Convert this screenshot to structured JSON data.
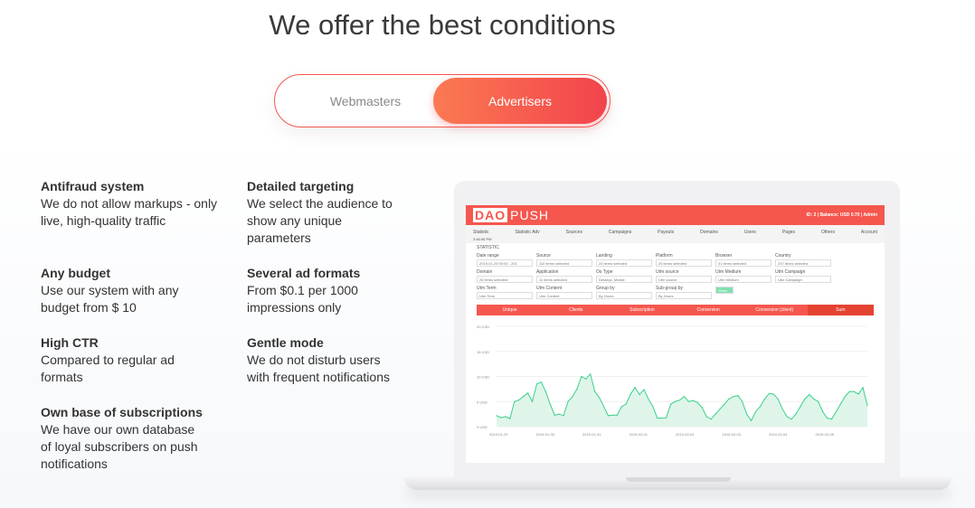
{
  "heading": "We offer the best conditions",
  "toggle": {
    "options": [
      "Webmasters",
      "Advertisers"
    ],
    "active": "Advertisers"
  },
  "features": [
    {
      "title": "Antifraud system",
      "text": "We do not allow markups - only live, high-quality traffic"
    },
    {
      "title": "Detailed targeting",
      "text": "We select the audience to show any unique parameters"
    },
    {
      "title": "Any budget",
      "text": "Use our system with any budget from $ 10"
    },
    {
      "title": "Several ad formats",
      "text": "From $0.1 per 1000 impressions only"
    },
    {
      "title": "High CTR",
      "text": "Compared to regular ad formats"
    },
    {
      "title": "Gentle mode",
      "text": "We do not disturb users with frequent notifications"
    },
    {
      "title": "Own base of subscriptions",
      "text": "We have our own database of loyal subscribers on push notifications"
    }
  ],
  "screen": {
    "logo": "DAO PUSH",
    "logo_a": "DAO",
    "logo_b": "PUSH",
    "top_right": "ID: 2  |  Balance: USD 0.70  |  Admin",
    "nav": [
      "Statistic",
      "Statistic Adv",
      "Sources",
      "Campaigns",
      "Payouts",
      "Domains",
      "Users",
      "Pages",
      "Others",
      "Account"
    ],
    "time": "3:46:06 PM",
    "section": "STATISTIC",
    "filters": [
      [
        {
          "label": "Date range",
          "value": "2019-01-29 00:00 - 201"
        },
        {
          "label": "Source",
          "value": "110 items selected"
        },
        {
          "label": "Landing",
          "value": "24 items selected"
        },
        {
          "label": "Platform",
          "value": "25 items selected"
        },
        {
          "label": "Browser",
          "value": "31 items selected"
        },
        {
          "label": "Country",
          "value": "237 items selected"
        }
      ],
      [
        {
          "label": "Domain",
          "value": "26 items selected"
        },
        {
          "label": "Application",
          "value": "11 items selected"
        },
        {
          "label": "Os Type",
          "value": "Desktop, Mobile"
        },
        {
          "label": "Utm source",
          "value": "Utm source"
        },
        {
          "label": "Utm Medium",
          "value": "Utm Medium"
        },
        {
          "label": "Utm Campaign",
          "value": "Utm Campaign"
        }
      ],
      [
        {
          "label": "Utm Term",
          "value": "Utm Term"
        },
        {
          "label": "Utm Content",
          "value": "Utm Content"
        },
        {
          "label": "Group by",
          "value": "By Hours"
        },
        {
          "label": "Sub-group by",
          "value": "By Hours"
        },
        {
          "label": "",
          "value": "Show"
        }
      ]
    ],
    "metric_tabs": [
      "Unique",
      "Clients",
      "Subscription",
      "Conversion",
      "Conversion (client)",
      "Sum"
    ],
    "active_metric": "Sum"
  },
  "chart_data": {
    "type": "area",
    "y_ticks": [
      "20 USD",
      "15 USD",
      "10 USD",
      "5 USD",
      "0 USD"
    ],
    "ylim": [
      0,
      20
    ],
    "x_ticks": [
      "2019-01-29",
      "2019-01-30",
      "2019-01-31",
      "2019-02-01",
      "2019-02-02",
      "2019-02-03",
      "2019-02-04",
      "2019-02-05"
    ],
    "values": [
      2.2,
      1.8,
      2,
      1.6,
      5,
      5.3,
      6,
      6.7,
      5,
      8.5,
      8.9,
      7,
      4.5,
      2.3,
      2.5,
      2.2,
      5,
      6,
      7.5,
      10,
      9.5,
      10.5,
      7,
      5.8,
      4,
      2.2,
      2.3,
      2.3,
      4,
      4.5,
      6.5,
      7.8,
      6.4,
      7.4,
      5.5,
      4,
      1.7,
      1.7,
      1.8,
      4.5,
      5,
      5.3,
      6,
      5,
      5.2,
      4.8,
      3.8,
      2,
      1.5,
      2.5,
      3.5,
      4.5,
      5.5,
      6,
      6.2,
      5,
      2.5,
      1.2,
      3,
      4,
      5.5,
      6.6,
      6.5,
      5.5,
      3.5,
      2,
      1.5,
      2.5,
      4,
      5.5,
      6.4,
      5.5,
      5,
      3,
      1.7,
      1.5,
      3,
      4.5,
      6,
      7,
      7,
      6.5,
      7.8,
      4.2
    ],
    "color": "#3ad08a"
  }
}
